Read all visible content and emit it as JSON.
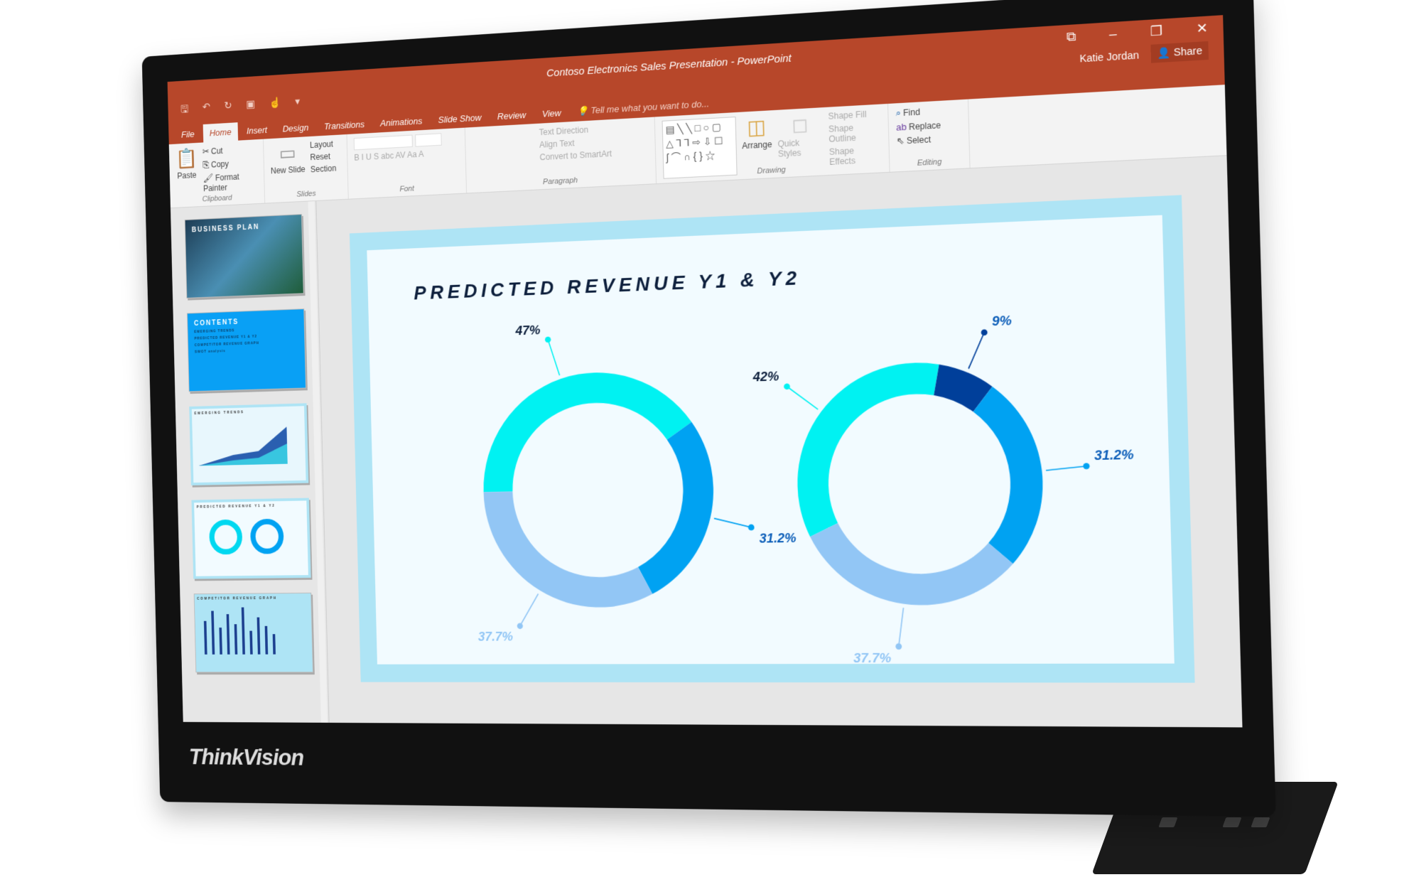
{
  "window": {
    "title": "Contoso Electronics Sales Presentation - PowerPoint",
    "user": "Katie Jordan",
    "share": "Share",
    "tell_me": "Tell me what you want to do..."
  },
  "tabs": [
    "File",
    "Home",
    "Insert",
    "Design",
    "Transitions",
    "Animations",
    "Slide Show",
    "Review",
    "View"
  ],
  "active_tab": "Home",
  "ribbon": {
    "clipboard": {
      "label": "Clipboard",
      "paste": "Paste",
      "cut": "Cut",
      "copy": "Copy",
      "format_painter": "Format Painter"
    },
    "slides": {
      "label": "Slides",
      "new_slide": "New Slide",
      "layout": "Layout",
      "reset": "Reset",
      "section": "Section"
    },
    "font": {
      "label": "Font",
      "buttons": "B I U S abc AV Aa A"
    },
    "paragraph": {
      "label": "Paragraph",
      "text_direction": "Text Direction",
      "align_text": "Align Text",
      "convert": "Convert to SmartArt"
    },
    "drawing": {
      "label": "Drawing",
      "arrange": "Arrange",
      "quick_styles": "Quick Styles",
      "shape_fill": "Shape Fill",
      "shape_outline": "Shape Outline",
      "shape_effects": "Shape Effects"
    },
    "editing": {
      "label": "Editing",
      "find": "Find",
      "replace": "Replace",
      "select": "Select"
    }
  },
  "thumbnails": [
    {
      "title": "BUSINESS PLAN"
    },
    {
      "title": "CONTENTS",
      "items": [
        "EMERGING TRENDS",
        "PREDICTED REVENUE Y1 & Y2",
        "COMPETITOR REVENUE GRAPH",
        "SWOT analysis"
      ]
    },
    {
      "title": "EMERGING TRENDS"
    },
    {
      "title": "PREDICTED REVENUE Y1 & Y2"
    },
    {
      "title": "COMPETITOR REVENUE GRAPH"
    }
  ],
  "brand": "ThinkVision",
  "slide": {
    "title": "PREDICTED REVENUE Y1 & Y2"
  },
  "colors": {
    "accent": "#b7472a",
    "cyan": "#00f2f2",
    "blue": "#00a2f2",
    "light": "#92c6f5",
    "dark": "#003f9a"
  },
  "chart_data": [
    {
      "type": "pie",
      "style": "donut",
      "segments": [
        {
          "label": "47%",
          "value": 47,
          "color": "#00f2f2"
        },
        {
          "label": "31.2%",
          "value": 31.2,
          "color": "#00a2f2"
        },
        {
          "label": "37.7%",
          "value": 37.7,
          "color": "#92c6f5"
        }
      ]
    },
    {
      "type": "pie",
      "style": "donut",
      "segments": [
        {
          "label": "42%",
          "value": 42,
          "color": "#00f2f2"
        },
        {
          "label": "9%",
          "value": 9,
          "color": "#003f9a"
        },
        {
          "label": "31.2%",
          "value": 31.2,
          "color": "#00a2f2"
        },
        {
          "label": "37.7%",
          "value": 37.7,
          "color": "#92c6f5"
        }
      ]
    }
  ]
}
